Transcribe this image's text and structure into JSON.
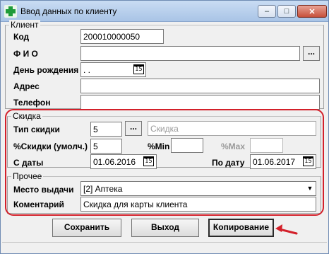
{
  "window": {
    "title": "Ввод данных по клиенту",
    "minimize_label": "–",
    "maximize_label": "□",
    "close_label": "✕"
  },
  "client_group": {
    "legend": "Клиент",
    "code_label": "Код",
    "code_value": "200010000050",
    "fio_label": "Ф И О",
    "fio_value": "",
    "fio_button": "...",
    "birthday_label": "День рождения",
    "birthday_value": " .  .",
    "address_label": "Адрес",
    "address_value": "",
    "phone_label": "Телефон",
    "phone_value": ""
  },
  "discount_group": {
    "legend": "Скидка",
    "type_label": "Тип скидки",
    "type_value": "5",
    "type_button": "...",
    "type_name_placeholder": "Скидка",
    "default_pct_label": "%Скидки (умолч.)",
    "default_pct_value": "5",
    "min_label": "%Min",
    "min_value": "",
    "max_label": "%Max",
    "max_value": "",
    "from_label": "С даты",
    "from_value": "01.06.2016",
    "to_label": "По дату",
    "to_value": "01.06.2017",
    "calendar_glyph": "15"
  },
  "other_group": {
    "legend": "Прочее",
    "place_label": "Место выдачи",
    "place_value": "[2] Аптека",
    "comment_label": "Коментарий",
    "comment_value": "Скидка для карты клиента"
  },
  "buttons": {
    "save": "Сохранить",
    "exit": "Выход",
    "copy": "Копирование"
  },
  "colors": {
    "highlight": "#d3202a",
    "app_icon": "#1f9b3a"
  }
}
